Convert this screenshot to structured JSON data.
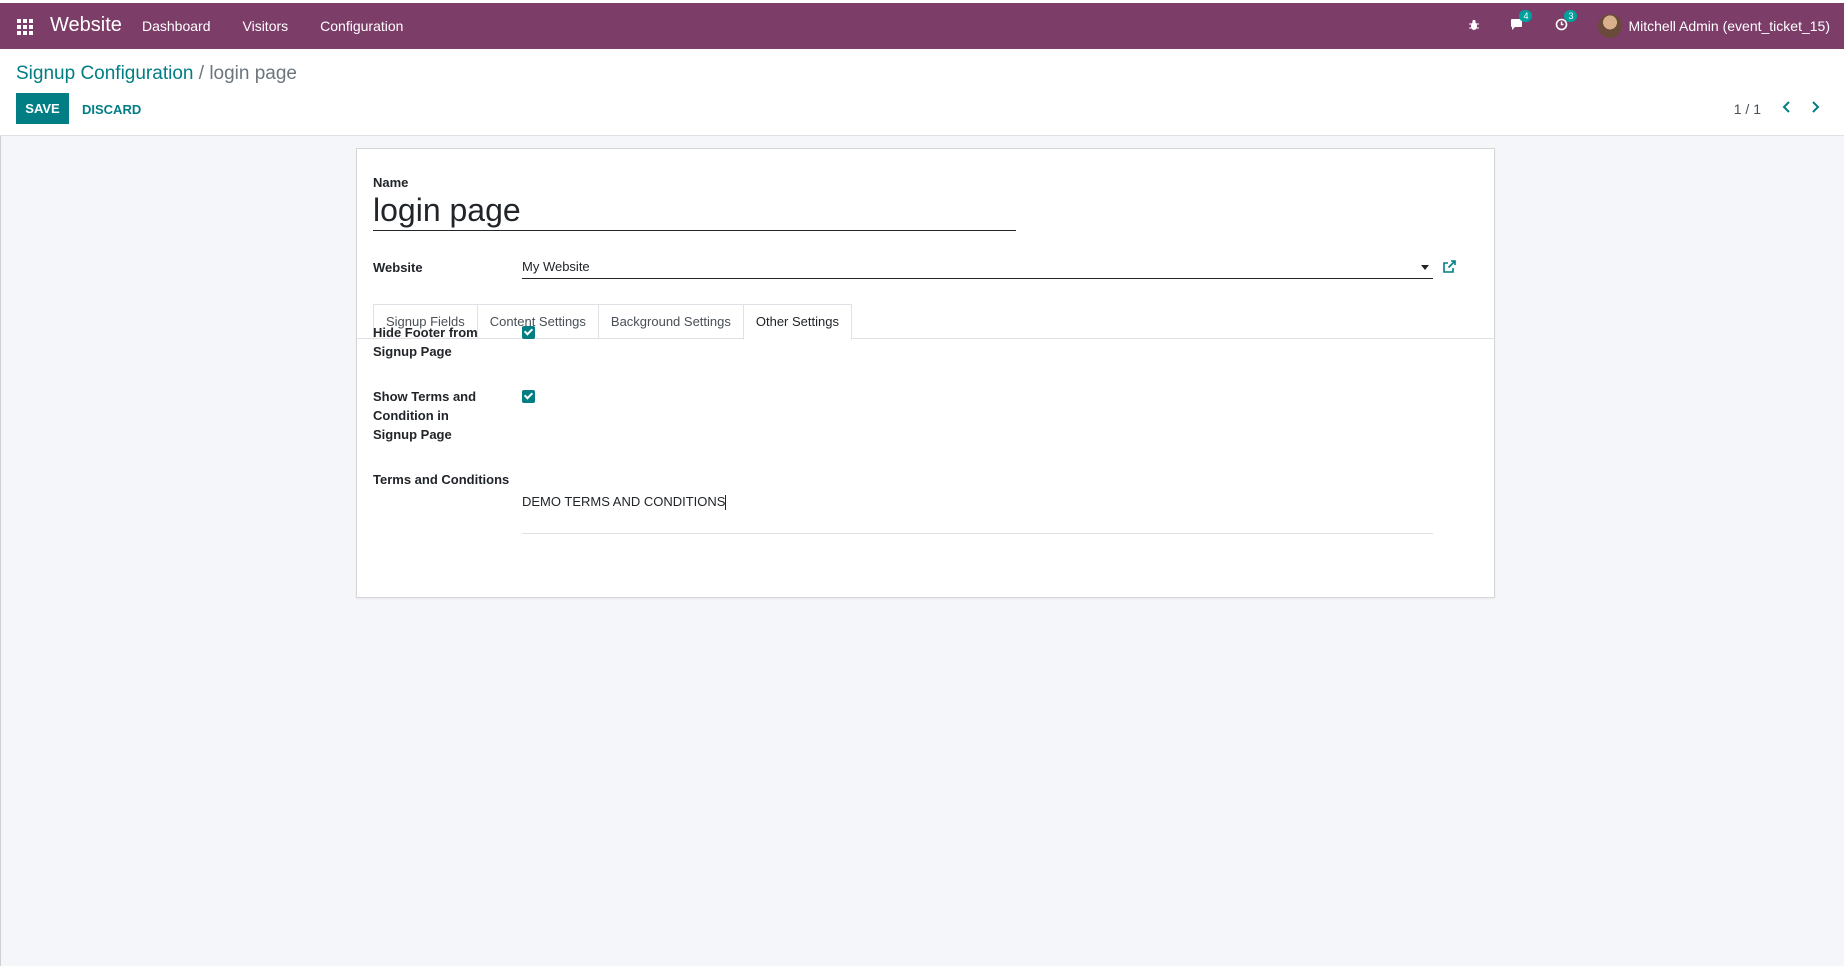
{
  "navbar": {
    "app_name": "Website",
    "menu": [
      "Dashboard",
      "Visitors",
      "Configuration"
    ],
    "messages_count": "4",
    "activities_count": "3",
    "user_name": "Mitchell Admin (event_ticket_15)"
  },
  "breadcrumb": {
    "parent": "Signup Configuration",
    "separator": "/",
    "current": "login page"
  },
  "actions": {
    "save_label": "SAVE",
    "discard_label": "DISCARD"
  },
  "pager": {
    "value": "1 / 1"
  },
  "form": {
    "name_label": "Name",
    "name_value": "login page",
    "website_label": "Website",
    "website_value": "My Website",
    "tabs": [
      "Signup Fields",
      "Content Settings",
      "Background Settings",
      "Other Settings"
    ],
    "active_tab": "Other Settings",
    "hide_footer_label": "Hide Footer from Signup Page",
    "hide_footer_checked": true,
    "show_terms_label": "Show Terms and Condition in Signup Page",
    "show_terms_checked": true,
    "terms_label": "Terms and Conditions",
    "terms_value": "DEMO TERMS AND CONDITIONS"
  },
  "colors": {
    "navbar": "#7c3d69",
    "accent": "#017e84",
    "badge": "#00a09d"
  }
}
